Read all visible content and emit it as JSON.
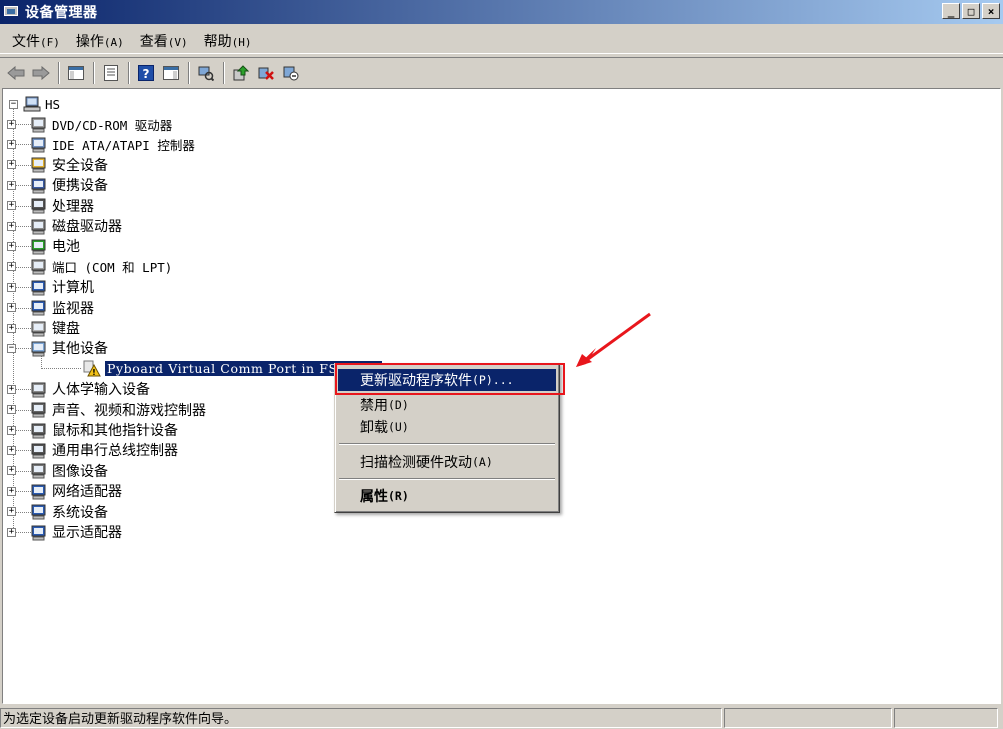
{
  "window": {
    "title": "设备管理器",
    "controls": {
      "minimize": "_",
      "maximize": "□",
      "close": "×"
    }
  },
  "menubar": {
    "items": [
      {
        "label": "文件",
        "accel": "(F)"
      },
      {
        "label": "操作",
        "accel": "(A)"
      },
      {
        "label": "查看",
        "accel": "(V)"
      },
      {
        "label": "帮助",
        "accel": "(H)"
      }
    ]
  },
  "toolbar": {
    "buttons": [
      "back-arrow-icon",
      "forward-arrow-icon",
      "show-hide-console-tree-icon",
      "properties-icon",
      "help-icon",
      "action-pane-icon",
      "scan-hardware-icon",
      "update-driver-icon",
      "uninstall-icon",
      "disable-icon"
    ]
  },
  "tree": {
    "root": "HS",
    "items": [
      {
        "label": "DVD/CD-ROM 驱动器",
        "icon": "dvd-drive-icon",
        "expander": "+"
      },
      {
        "label": "IDE ATA/ATAPI 控制器",
        "icon": "ide-controller-icon",
        "expander": "+"
      },
      {
        "label": "安全设备",
        "icon": "key-icon",
        "expander": "+"
      },
      {
        "label": "便携设备",
        "icon": "portable-device-icon",
        "expander": "+"
      },
      {
        "label": "处理器",
        "icon": "processor-icon",
        "expander": "+"
      },
      {
        "label": "磁盘驱动器",
        "icon": "disk-drive-icon",
        "expander": "+"
      },
      {
        "label": "电池",
        "icon": "battery-icon",
        "expander": "+"
      },
      {
        "label": "端口 (COM 和 LPT)",
        "icon": "port-icon",
        "expander": "+"
      },
      {
        "label": "计算机",
        "icon": "computer-icon",
        "expander": "+"
      },
      {
        "label": "监视器",
        "icon": "monitor-icon",
        "expander": "+"
      },
      {
        "label": "键盘",
        "icon": "keyboard-icon",
        "expander": "+"
      },
      {
        "label": "其他设备",
        "icon": "unknown-device-icon",
        "expander": "−"
      },
      {
        "label": "人体学输入设备",
        "icon": "hid-icon",
        "expander": "+"
      },
      {
        "label": "声音、视频和游戏控制器",
        "icon": "speaker-icon",
        "expander": "+"
      },
      {
        "label": "鼠标和其他指针设备",
        "icon": "mouse-icon",
        "expander": "+"
      },
      {
        "label": "通用串行总线控制器",
        "icon": "usb-icon",
        "expander": "+"
      },
      {
        "label": "图像设备",
        "icon": "camera-icon",
        "expander": "+"
      },
      {
        "label": "网络适配器",
        "icon": "network-adapter-icon",
        "expander": "+"
      },
      {
        "label": "系统设备",
        "icon": "system-device-icon",
        "expander": "+"
      },
      {
        "label": "显示适配器",
        "icon": "display-adapter-icon",
        "expander": "+"
      }
    ],
    "selected_child": "Pyboard Virtual Comm Port in FS Mode"
  },
  "context_menu": {
    "items": [
      {
        "label": "更新驱动程序软件",
        "accel": "(P)...",
        "highlighted": true
      },
      {
        "label": "禁用",
        "accel": "(D)"
      },
      {
        "label": "卸载",
        "accel": "(U)"
      },
      {
        "label": "扫描检测硬件改动",
        "accel": "(A)"
      },
      {
        "label": "属性",
        "accel": "(R)",
        "bold": true
      }
    ]
  },
  "statusbar": {
    "text": "为选定设备启动更新驱动程序软件向导。"
  },
  "colors": {
    "titlebar_start": "#0a246a",
    "titlebar_end": "#a6caf0",
    "selection": "#0a246a",
    "annotation_red": "#e8161c",
    "window_face": "#d4d0c8"
  }
}
